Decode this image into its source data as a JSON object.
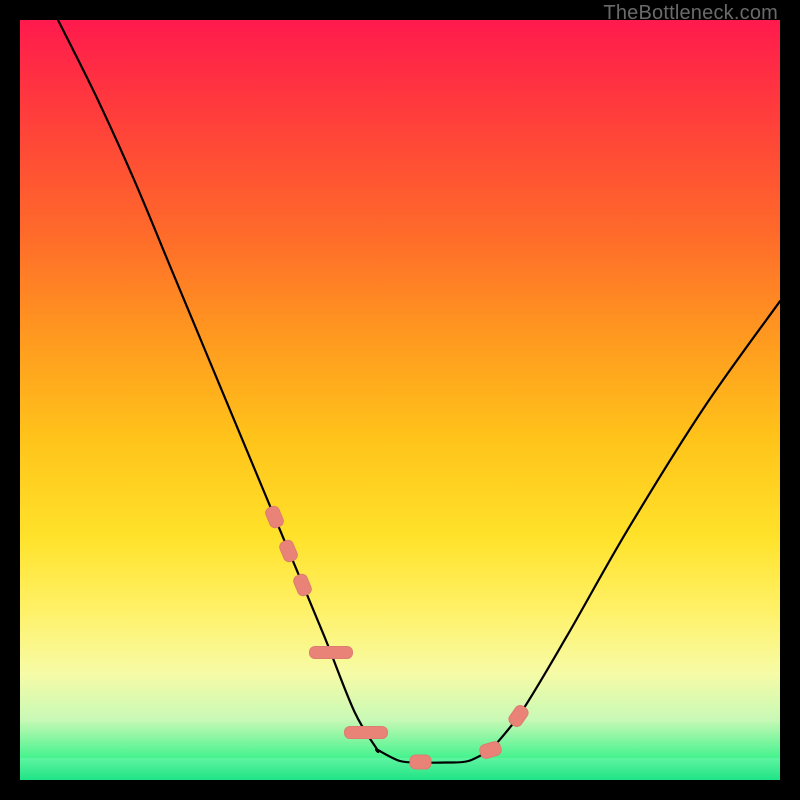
{
  "attribution": "TheBottleneck.com",
  "colors": {
    "bead": "#e98377",
    "curve": "#000000",
    "frame": "#000000"
  },
  "chart_data": {
    "type": "line",
    "title": "",
    "xlabel": "",
    "ylabel": "",
    "xlim": [
      0,
      100
    ],
    "ylim": [
      0,
      100
    ],
    "grid": false,
    "series": [
      {
        "name": "well-curve-left",
        "x": [
          5,
          10,
          15,
          20,
          25,
          30,
          35,
          40,
          44,
          47
        ],
        "y": [
          100,
          90,
          79,
          67,
          55,
          43,
          31,
          19,
          9,
          4
        ]
      },
      {
        "name": "well-floor",
        "x": [
          47,
          50,
          53,
          56,
          59,
          62
        ],
        "y": [
          4,
          2.5,
          2.3,
          2.3,
          2.5,
          4
        ]
      },
      {
        "name": "well-curve-right",
        "x": [
          62,
          66,
          72,
          80,
          90,
          100
        ],
        "y": [
          4,
          9,
          19,
          33,
          49,
          63
        ]
      }
    ],
    "beads": [
      {
        "path_frac": 0.37,
        "size": "sm"
      },
      {
        "path_frac": 0.395,
        "size": "sm"
      },
      {
        "path_frac": 0.42,
        "size": "sm"
      },
      {
        "path_frac": 0.47,
        "size": "lg"
      },
      {
        "path_frac": 0.53,
        "size": "lg"
      },
      {
        "path_frac": 0.58,
        "size": "sm"
      },
      {
        "path_frac": 0.63,
        "size": "sm"
      },
      {
        "path_frac": 0.665,
        "size": "sm"
      }
    ]
  }
}
